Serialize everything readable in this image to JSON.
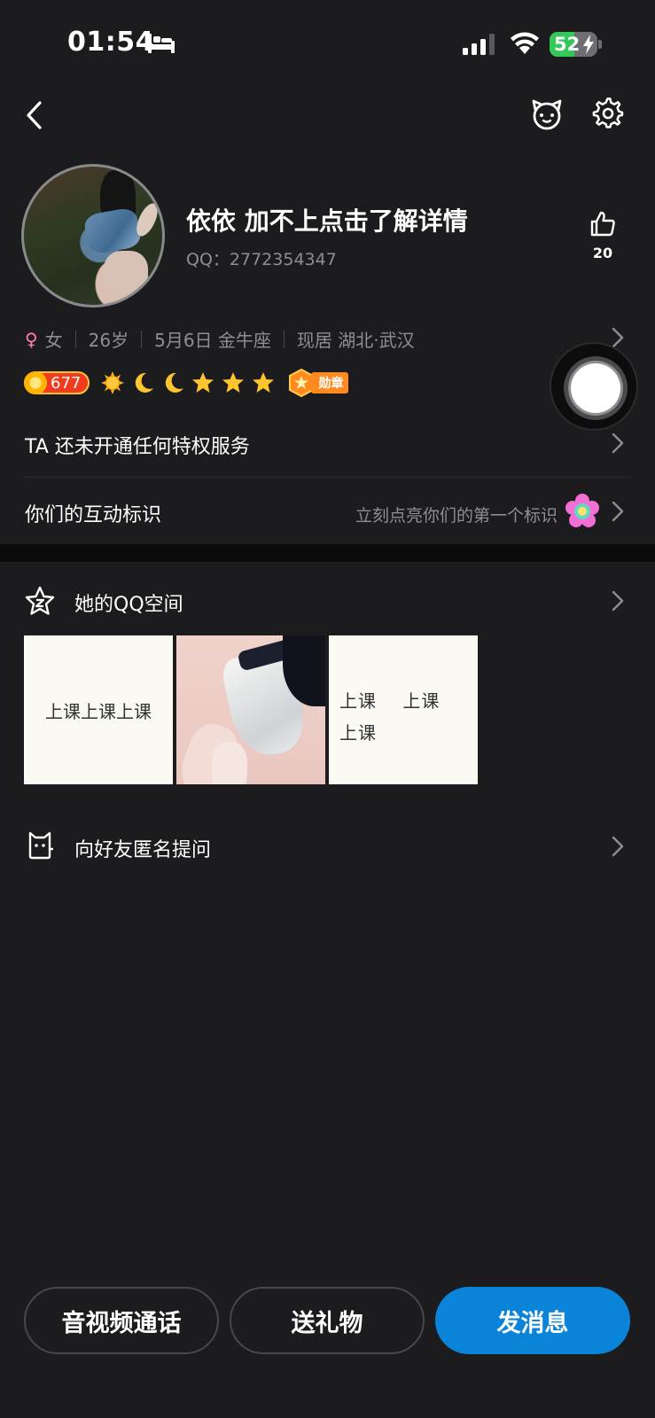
{
  "status_bar": {
    "time": "01:54",
    "battery_level": "52",
    "battery_fill": 0.52,
    "icons": [
      "bed-icon",
      "signal-icon",
      "wifi-icon",
      "battery-icon"
    ]
  },
  "nav": {
    "icons": [
      "back-icon",
      "pet-icon",
      "gear-icon"
    ]
  },
  "profile": {
    "name": "依依 加不上点击了解详情",
    "qq_label": "QQ：",
    "qq_number": "2772354347",
    "likes": "20",
    "gender": "女",
    "age": "26岁",
    "birthday": "5月6日 金牛座",
    "location": "现居 湖北·武汉",
    "level": "677",
    "medal_label": "勋章"
  },
  "rows": {
    "privilege": "TA 还未开通任何特权服务",
    "interaction_label": "你们的互动标识",
    "interaction_hint": "立刻点亮你们的第一个标识",
    "qzone": "她的QQ空间",
    "ask": "向好友匿名提问"
  },
  "photos": {
    "p1_text": "上课上课上课",
    "p3_text": "上课 上课 上课"
  },
  "actions": {
    "call": "音视频通话",
    "gift": "送礼物",
    "message": "发消息"
  },
  "colors": {
    "background": "#1c1c1e",
    "primary_button": "#0a84d8",
    "battery_green": "#34c759",
    "level_red": "#f23a1e",
    "female_pink": "#ff7fb0"
  }
}
